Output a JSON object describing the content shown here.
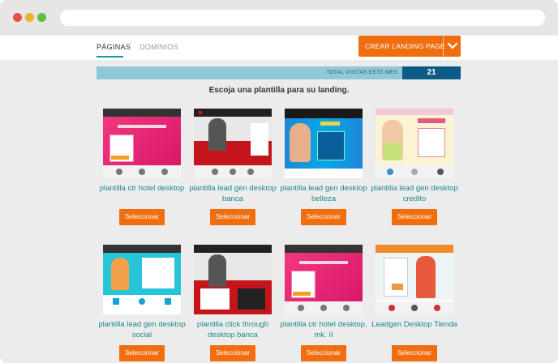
{
  "nav": {
    "tabs": [
      {
        "label": "PÁGINAS"
      },
      {
        "label": "DOMINIOS"
      }
    ],
    "create_button": "CREAR LANDING PAGE"
  },
  "stats": {
    "visits_label": "TOTAL VISITAS ESTE MES",
    "visits_value": "21"
  },
  "subtitle": "Escoja una plantilla para su landing.",
  "select_label": "Seleccionar",
  "templates": [
    {
      "name": "plantilla ctr hotel desktop"
    },
    {
      "name": "plantilla lead gen desktop banca"
    },
    {
      "name": "plantilla lead gen desktop belleza"
    },
    {
      "name": "plantilla lead gen desktop credito"
    },
    {
      "name": "plantilla lead gen desktop social"
    },
    {
      "name": "plantilla click through desktop banca"
    },
    {
      "name": "plantilla ctr hotel desktop, mk. II"
    },
    {
      "name": "Leadgen Desktop Tienda"
    }
  ],
  "colors": {
    "accent": "#f06e10",
    "teal_text": "#1a8a8c",
    "visits_bar": "#8ec9da",
    "visits_count_bg": "#0c5b86"
  }
}
